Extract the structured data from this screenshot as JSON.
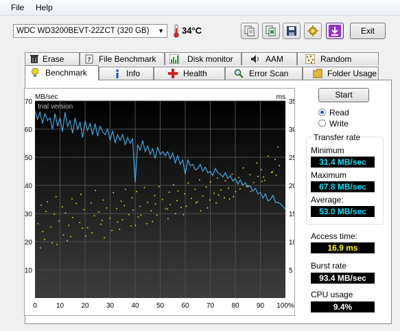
{
  "menu": {
    "file": "File",
    "help": "Help"
  },
  "toolbar": {
    "drive": "WDC WD3200BEVT-22ZCT (320 GB)",
    "temperature": "34°C",
    "exit": "Exit",
    "icons": [
      "copy-text-icon",
      "copy-screenshot-icon",
      "save-icon",
      "options-icon",
      "download-icon"
    ]
  },
  "tabs_top": [
    "Erase",
    "File Benchmark",
    "Disk monitor",
    "AAM",
    "Random Access"
  ],
  "tabs_bottom": [
    "Benchmark",
    "Info",
    "Health",
    "Error Scan",
    "Folder Usage"
  ],
  "active_tab": "Benchmark",
  "controls": {
    "start": "Start",
    "read": "Read",
    "write": "Write",
    "mode_selected": "Read"
  },
  "results": {
    "transfer_rate_title": "Transfer rate",
    "minimum_label": "Minimum",
    "minimum": "31.4 MB/sec",
    "maximum_label": "Maximum",
    "maximum": "67.8 MB/sec",
    "average_label": "Average:",
    "average": "53.0 MB/sec",
    "access_label": "Access time:",
    "access": "16.9 ms",
    "burst_label": "Burst rate",
    "burst": "93.4 MB/sec",
    "cpu_label": "CPU usage",
    "cpu": "9.4%"
  },
  "colors": {
    "transfer_line": "#3da9e0",
    "access_dots": "#e5e51a",
    "plot_bg": "#1a1a1a",
    "grid": "#4d4d4d"
  },
  "chart_data": {
    "type": "line",
    "watermark": "trial version",
    "y_left_unit": "MB/sec",
    "y_right_unit": "ms",
    "xlim": [
      0,
      100
    ],
    "ylim_left": [
      0,
      70
    ],
    "ylim_right": [
      0,
      35
    ],
    "x_ticks": [
      "0",
      "10",
      "20",
      "30",
      "40",
      "50",
      "60",
      "70",
      "80",
      "90",
      "100%"
    ],
    "y_left_ticks": [
      "10",
      "20",
      "30",
      "40",
      "50",
      "60",
      "70"
    ],
    "y_right_ticks": [
      "5",
      "10",
      "15",
      "20",
      "25",
      "30",
      "35"
    ],
    "series": [
      {
        "kind": "transfer-line",
        "x": [
          0,
          1,
          2,
          3,
          4,
          5,
          6,
          7,
          8,
          9,
          10,
          11,
          12,
          13,
          14,
          15,
          16,
          17,
          18,
          19,
          20,
          21,
          22,
          23,
          24,
          25,
          26,
          27,
          28,
          29,
          30,
          31,
          32,
          33,
          34,
          35,
          36,
          37,
          38,
          39,
          40,
          41,
          42,
          43,
          44,
          45,
          46,
          47,
          48,
          49,
          50,
          51,
          52,
          53,
          54,
          55,
          56,
          57,
          58,
          59,
          60,
          61,
          62,
          63,
          64,
          65,
          66,
          67,
          68,
          69,
          70,
          71,
          72,
          73,
          74,
          75,
          76,
          77,
          78,
          79,
          80,
          81,
          82,
          83,
          84,
          85,
          86,
          87,
          88,
          89,
          90,
          91,
          92,
          93,
          94,
          95,
          96,
          97,
          98,
          99,
          100
        ],
        "y": [
          66.5,
          63.5,
          66,
          62,
          65.5,
          63,
          64,
          60,
          65.5,
          61,
          64,
          59,
          66,
          61,
          63,
          58.5,
          64,
          60,
          62.5,
          57,
          63,
          59.5,
          62,
          58,
          62,
          57.5,
          61,
          59,
          58,
          60,
          56,
          59.5,
          55,
          58,
          56,
          58,
          54.5,
          57,
          55,
          56.5,
          41,
          54.5,
          52.5,
          56,
          52,
          54,
          51,
          53,
          49.5,
          53.5,
          51,
          52,
          50.5,
          52,
          49.5,
          51.5,
          48,
          50.5,
          47.5,
          49,
          44,
          49,
          47,
          47.5,
          45.5,
          46,
          47.5,
          45,
          46.5,
          44.5,
          45,
          43.5,
          46,
          44.5,
          44,
          43,
          44.5,
          42.5,
          43.5,
          41.5,
          42.5,
          40.5,
          42,
          40,
          41,
          39.5,
          39.8,
          38,
          39,
          37,
          37.5,
          35.5,
          37,
          34.5,
          35,
          36.5,
          34,
          34,
          33.5,
          32.5,
          31.5
        ]
      },
      {
        "kind": "access-time-scatter",
        "x": [
          1.2,
          2.5,
          3.1,
          4.4,
          5.0,
          6.3,
          7.7,
          8.4,
          9.6,
          10.9,
          12.2,
          13.5,
          14.8,
          15.1,
          16.5,
          17.9,
          18.3,
          19.6,
          21.0,
          22.4,
          23.7,
          24.1,
          25.5,
          26.8,
          27.2,
          28.6,
          29.9,
          31.3,
          32.6,
          33.0,
          34.4,
          35.7,
          36.1,
          37.5,
          38.8,
          39.2,
          40.6,
          41.9,
          42.3,
          43.7,
          45.0,
          46.4,
          47.8,
          48.1,
          49.5,
          50.9,
          52.2,
          53.6,
          54.0,
          55.3,
          56.7,
          57.1,
          58.4,
          59.8,
          61.2,
          62.5,
          63.9,
          64.3,
          65.7,
          67.0,
          68.4,
          69.8,
          70.1,
          71.5,
          72.9,
          74.2,
          75.6,
          76.0,
          77.3,
          78.7,
          80.1,
          81.4,
          82.8,
          83.2,
          84.5,
          85.9,
          87.3,
          88.6,
          89.0,
          90.4,
          91.8,
          93.1,
          94.5,
          95.9,
          96.3,
          97.6,
          3.8,
          6.9,
          11.4,
          14.2,
          18.9,
          22.8,
          26.3,
          30.7,
          34.9,
          38.3,
          41.2,
          44.6,
          48.7,
          52.9,
          56.1,
          60.4,
          64.8,
          68.9,
          73.3,
          77.7,
          81.9,
          86.2,
          90.6,
          94.8,
          2.1,
          8.8,
          12.9,
          20.3,
          27.7,
          33.8,
          40.1,
          46.9,
          53.1,
          59.3,
          66.2,
          72.4,
          79.2,
          85.1,
          91.3,
          97.0
        ],
        "y": [
          13.2,
          16.5,
          11.8,
          15.4,
          17.1,
          12.6,
          14.9,
          18.0,
          13.7,
          16.2,
          15.1,
          12.9,
          17.6,
          14.3,
          16.8,
          13.4,
          18.4,
          15.7,
          12.5,
          16.9,
          14.6,
          19.1,
          15.3,
          13.8,
          17.4,
          16.0,
          14.2,
          18.7,
          15.9,
          13.5,
          17.2,
          16.4,
          19.3,
          14.8,
          17.8,
          15.6,
          18.9,
          16.3,
          14.7,
          19.6,
          17.0,
          15.5,
          18.2,
          16.7,
          19.8,
          17.5,
          15.9,
          18.8,
          16.6,
          20.1,
          17.3,
          19.0,
          16.1,
          18.5,
          20.4,
          17.7,
          19.3,
          16.9,
          21.0,
          18.1,
          19.7,
          17.4,
          20.6,
          18.6,
          21.3,
          19.2,
          17.8,
          20.8,
          19.5,
          22.0,
          18.9,
          21.4,
          20.2,
          23.1,
          19.8,
          21.9,
          20.5,
          24.0,
          21.6,
          22.8,
          20.9,
          25.2,
          22.3,
          24.6,
          21.8,
          23.5,
          10.4,
          9.8,
          11.2,
          10.9,
          12.4,
          11.6,
          13.1,
          12.0,
          13.9,
          12.8,
          14.4,
          13.2,
          14.7,
          15.8,
          15.0,
          16.3,
          17.1,
          16.0,
          18.3,
          17.6,
          19.4,
          18.9,
          20.7,
          22.4,
          8.9,
          9.5,
          10.2,
          11.0,
          10.7,
          12.2,
          12.9,
          13.6,
          14.1,
          14.8,
          15.5,
          16.9,
          18.0,
          19.9,
          21.5,
          26.8
        ]
      }
    ]
  }
}
